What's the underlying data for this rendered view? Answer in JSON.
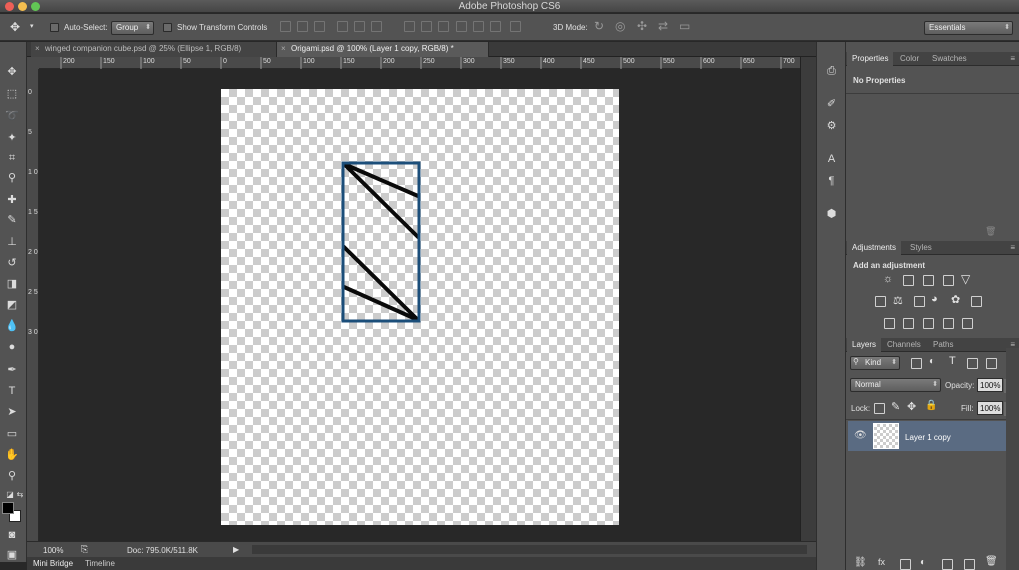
{
  "window": {
    "title": "Adobe Photoshop CS6"
  },
  "options": {
    "auto_select_label": "Auto-Select:",
    "auto_select_value": "Group",
    "transform_label": "Show Transform Controls",
    "mode_3d_label": "3D Mode:",
    "workspace": "Essentials"
  },
  "tabs": [
    {
      "label": "winged companion cube.psd @ 25% (Ellipse 1, RGB/8)"
    },
    {
      "label": "Origami.psd @ 100% (Layer 1 copy, RGB/8) *"
    }
  ],
  "ruler": {
    "h_ticks": [
      "200",
      "150",
      "100",
      "50",
      "0",
      "50",
      "100",
      "150",
      "200",
      "250",
      "300",
      "350",
      "400",
      "450",
      "500",
      "550",
      "600",
      "650",
      "700"
    ],
    "v_ticks": [
      "0",
      "5",
      "1 0",
      "1 5",
      "2 0",
      "2 5",
      "3 0"
    ]
  },
  "status": {
    "zoom": "100%",
    "doc": "Doc: 795.0K/511.8K"
  },
  "bottom_tabs": [
    "Mini Bridge",
    "Timeline"
  ],
  "properties": {
    "tabs": [
      "Properties",
      "Color",
      "Swatches"
    ],
    "content": "No Properties"
  },
  "adjustments": {
    "tabs": [
      "Adjustments",
      "Styles"
    ],
    "title": "Add an adjustment"
  },
  "layers": {
    "tabs": [
      "Layers",
      "Channels",
      "Paths"
    ],
    "filter": "Kind",
    "blend": "Normal",
    "opacity_label": "Opacity:",
    "opacity": "100%",
    "lock_label": "Lock:",
    "fill_label": "Fill:",
    "fill": "100%",
    "items": [
      {
        "name": "Layer 1 copy",
        "visible": true,
        "selected": true
      }
    ]
  },
  "colors": {
    "foreground": "#000000",
    "background": "#ffffff",
    "selection": "#1b4e7a",
    "accent": "#5a6b82"
  }
}
